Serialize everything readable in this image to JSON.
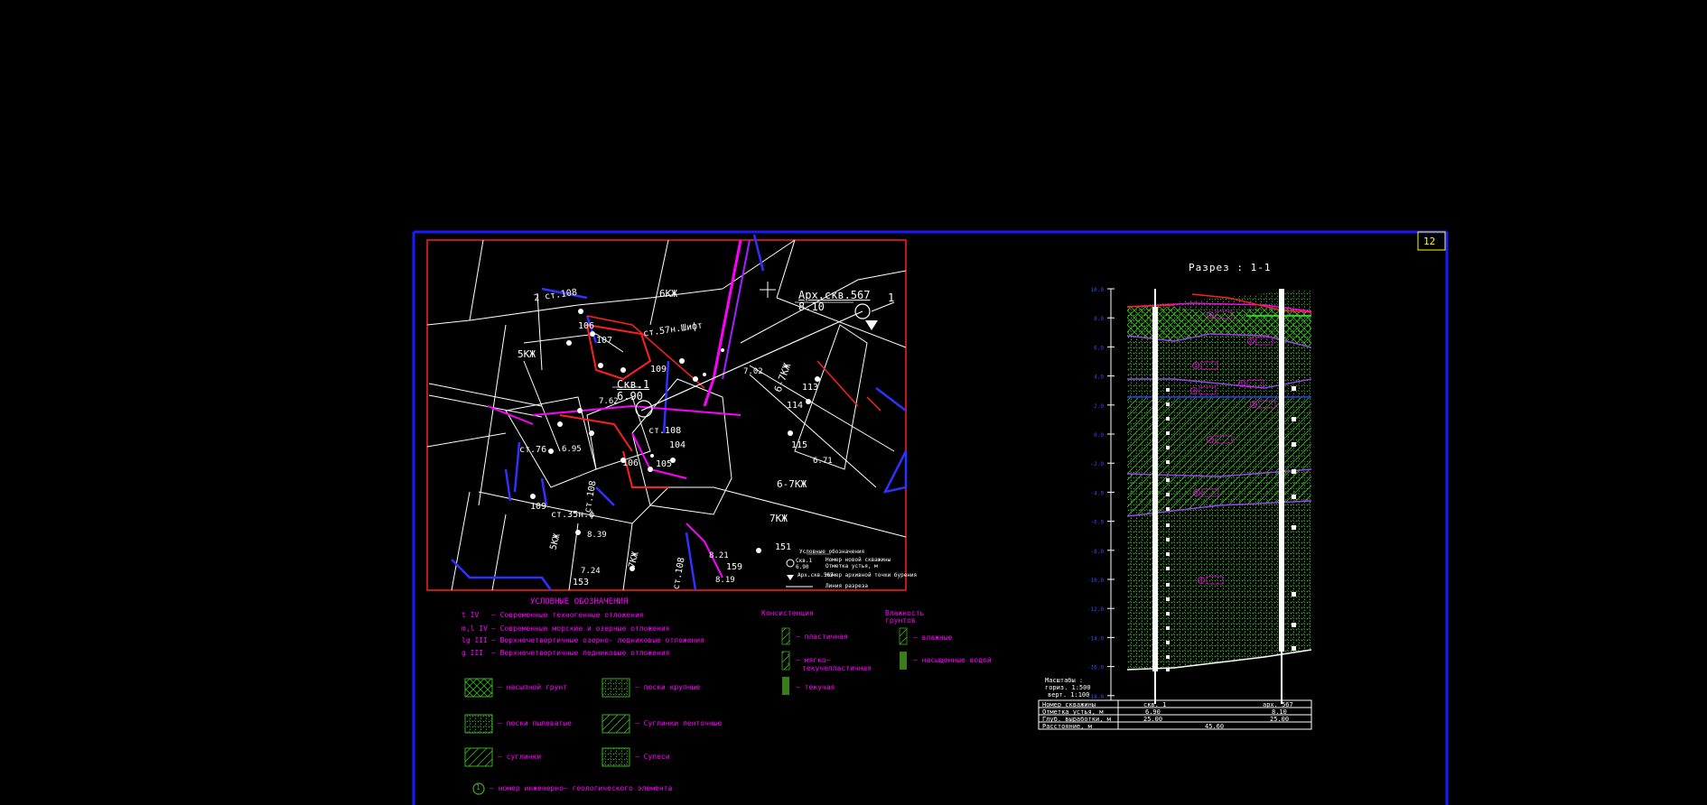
{
  "sheet": {
    "number": "12",
    "frame_color": "#0000ff",
    "background": "#000000"
  },
  "plan": {
    "frame_color": "#ff0000",
    "labels": {
      "block_6kzh_top": "6КЖ",
      "block_5kzh": "5КЖ",
      "block_6_7kzh_right": "6-7КЖ",
      "block_6_7kzh_mid": "6-7КЖ",
      "block_7kzh": "7КЖ",
      "block_7kzh_low": "7КЖ",
      "block_5kzh_low": "5КЖ",
      "building_1": "2 ст.108",
      "building_2": "ст.57н.Шифт",
      "building_3": "ст.108",
      "building_4": "ст.76",
      "building_5": "ст.35н.ф",
      "building_6": "ст.108",
      "building_7": "ст.108",
      "num_106a": "106",
      "num_107": "107",
      "num_109a": "109",
      "num_106b": "106",
      "num_104": "104",
      "num_105": "105",
      "num_109b": "109",
      "num_113": "113",
      "num_114": "114",
      "num_115": "115",
      "num_151": "151",
      "num_159": "159",
      "num_153": "153",
      "num_702": "7.02",
      "num_671": "6.71",
      "num_695": "6.95",
      "num_839": "8.39",
      "num_724": "7.24",
      "num_821": "8.21",
      "num_819": "8.19",
      "num_762": "7.62"
    },
    "well_main": {
      "name": "Скв.1",
      "elevation": "6.90"
    },
    "well_archive": {
      "name": "Арх.скв.567",
      "elevation": "8.10"
    },
    "section_mark": "1",
    "mini_legend": {
      "title": "Условные обозначения",
      "item1_label": "Скв.1",
      "item1_value": "6.90",
      "item1_desc_a": "Номер новой скважины",
      "item1_desc_b": "Отметка устья, м",
      "item2_label": "Арх.скв.567",
      "item2_desc": "Номер архивной точки бурения",
      "item3_desc": "Линия разреза"
    }
  },
  "legend": {
    "title": "УСЛОВНЫЕ ОБОЗНАЧЕНИЯ",
    "strata": [
      {
        "code": "t IV",
        "desc": "– Современные техногенные отложения"
      },
      {
        "code": "m,l IV",
        "desc": "– Современные морские и озерные отложения"
      },
      {
        "code": "lg III",
        "desc": "– Верхнечетвертичные озерно- ледниковые отложения"
      },
      {
        "code": "g III",
        "desc": "– Верхнечетвертичные ледниковые отложения"
      }
    ],
    "soils": [
      {
        "desc": "– насыпной грунт"
      },
      {
        "desc": "– пески крупные"
      },
      {
        "desc": "– пески пылеватые"
      },
      {
        "desc": "– Суглинки ленточные"
      },
      {
        "desc": "– суглинки"
      },
      {
        "desc": "– Супеси"
      }
    ],
    "element_desc": "– номер инженерно– геологического элемента",
    "element_num": "1",
    "consistency": {
      "title": "Консистенция",
      "items": [
        {
          "desc": "– пластичная"
        },
        {
          "desc": "– мягко–"
        },
        {
          "desc": "текучепластичная"
        },
        {
          "desc": "– текучая"
        }
      ]
    },
    "moisture": {
      "title": "Влажность",
      "title2": "грунтов",
      "items": [
        {
          "desc": "– влажные"
        },
        {
          "desc": "– насыщенные водой"
        }
      ]
    },
    "colors": {
      "text": "#ff00ff",
      "hatch": "#3cb01c",
      "fill": "#3a7d1c"
    }
  },
  "section": {
    "title": "Разрез : 1-1",
    "scale": {
      "line1": "Масштабы :",
      "line2": "гориз. 1:500",
      "line3": "верт. 1:100"
    },
    "axis_ticks": [
      "10.0",
      "8.0",
      "6.0",
      "4.0",
      "2.0",
      "0.0",
      "-2.0",
      "-4.0",
      "-6.0",
      "-8.0",
      "-10.0",
      "-12.0",
      "-14.0",
      "-16.0",
      "-18.0"
    ],
    "element_tags": [
      "1",
      "2",
      "3",
      "4",
      "5",
      "6",
      "7",
      "8",
      "9"
    ],
    "table": {
      "rows": [
        {
          "label": "Номер скважины",
          "v1": "скв. 1",
          "v2": "арх. 567"
        },
        {
          "label": "Отметка устья, м",
          "v1": "6.90",
          "v2": "8.10"
        },
        {
          "label": "Глуб. выработки, м",
          "v1": "25.00",
          "v2": "25.00"
        },
        {
          "label": "Расстояние, м",
          "v1": "",
          "v2": "",
          "mid": "45.60"
        }
      ]
    }
  }
}
